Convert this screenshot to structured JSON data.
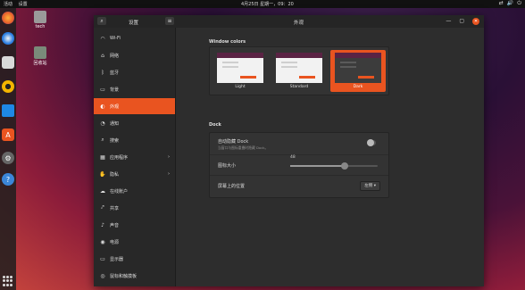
{
  "topbar": {
    "activities": "活动",
    "settings_app": "设置",
    "clock": "4月25日 星期一，09：20",
    "tray_network": "⇄",
    "tray_volume": "🔊",
    "tray_power": "⏻"
  },
  "desktop": {
    "icons": [
      {
        "label": "tech"
      },
      {
        "label": "回收站"
      }
    ]
  },
  "window": {
    "settings_title": "设置",
    "panel_title": "外观",
    "minimize": "—",
    "maximize": "▢",
    "close": "✕"
  },
  "sidebar": {
    "items": [
      {
        "label": "Wi-Fi",
        "icon": "wifi-icon",
        "glyph": "◠"
      },
      {
        "label": "网络",
        "icon": "network-icon",
        "glyph": "⌂"
      },
      {
        "label": "蓝牙",
        "icon": "bluetooth-icon",
        "glyph": "ᛒ"
      },
      {
        "label": "背景",
        "icon": "background-icon",
        "glyph": "▭"
      },
      {
        "label": "外观",
        "icon": "appearance-icon",
        "glyph": "◐"
      },
      {
        "label": "通知",
        "icon": "bell-icon",
        "glyph": "◔"
      },
      {
        "label": "搜索",
        "icon": "search-icon",
        "glyph": "⌕"
      },
      {
        "label": "应用程序",
        "icon": "apps-icon",
        "glyph": "▦",
        "chevron": "›"
      },
      {
        "label": "隐私",
        "icon": "privacy-icon",
        "glyph": "✋",
        "chevron": "›"
      },
      {
        "label": "在线账户",
        "icon": "cloud-icon",
        "glyph": "☁"
      },
      {
        "label": "共享",
        "icon": "share-icon",
        "glyph": "⤤"
      },
      {
        "label": "声音",
        "icon": "sound-icon",
        "glyph": "♪"
      },
      {
        "label": "电源",
        "icon": "power-icon",
        "glyph": "◉"
      },
      {
        "label": "显示器",
        "icon": "display-icon",
        "glyph": "▭"
      },
      {
        "label": "鼠标和触摸板",
        "icon": "mouse-icon",
        "glyph": "◎"
      }
    ],
    "active_index": 4
  },
  "content": {
    "window_colors_title": "Window colors",
    "themes": [
      {
        "label": "Light",
        "selected": false,
        "body": "#f2f2f2",
        "line": "#cfcfcf"
      },
      {
        "label": "Standard",
        "selected": false,
        "body": "#f2f2f2",
        "line": "#cfcfcf"
      },
      {
        "label": "Dark",
        "selected": true,
        "body": "#3c3c3c",
        "line": "#5a5a5a"
      }
    ],
    "dock_title": "Dock",
    "autohide_label": "自动隐藏 Dock",
    "autohide_desc": "当窗口与图标重叠时隐藏 Dock。",
    "autohide_on": false,
    "icon_size_label": "图标大小",
    "icon_size_value": "48",
    "icon_size_fraction": 0.62,
    "position_label": "屏幕上的位置",
    "position_value": "左侧 ▾"
  },
  "colors": {
    "accent": "#e95420",
    "titlebar": "#252525",
    "sidebar": "#282828",
    "content": "#2d2d2d"
  }
}
